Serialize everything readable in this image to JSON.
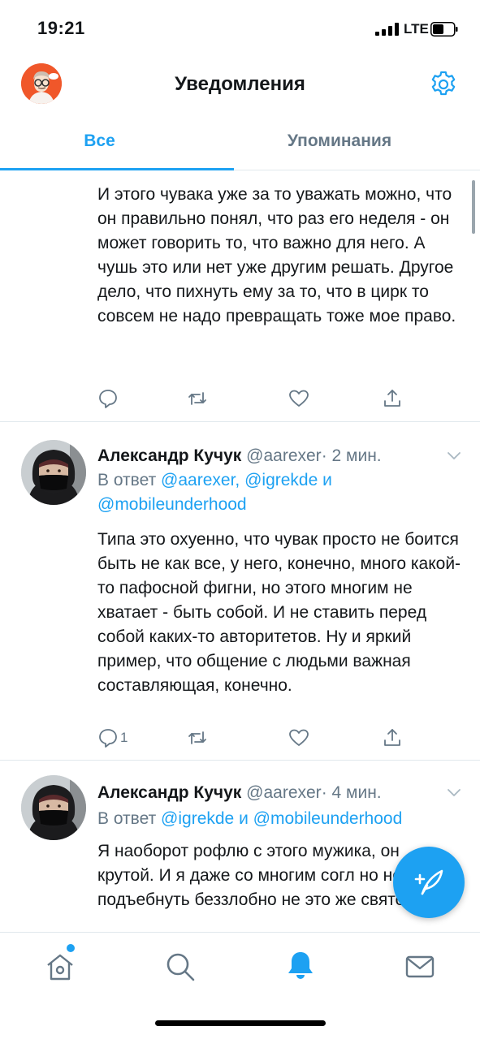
{
  "status_bar": {
    "time": "19:21",
    "network": "LTE"
  },
  "header": {
    "title": "Уведомления"
  },
  "tabs": [
    {
      "label": "Все",
      "active": true
    },
    {
      "label": "Упоминания",
      "active": false
    }
  ],
  "tweets": [
    {
      "text": "И этого чувака уже за то уважать можно, что он правильно понял, что раз его неделя - он может говорить то, что важно для него. А чушь это или нет уже другим решать. Другое дело, что пихнуть ему за то, что в цирк то совсем не надо превращать тоже мое право."
    },
    {
      "name": "Александр Кучук",
      "handle": "@aarexer",
      "separator": "·",
      "time": "2 мин.",
      "reply_prefix": "В ответ",
      "reply_links": [
        "@aarexer,",
        "@igrekde",
        "@mobileunderhood"
      ],
      "reply_joiner": "и",
      "text": "Типа это охуенно, что чувак просто не боится быть не как все, у него, конечно, много какой-то пафосной фигни, но этого многим не хватает - быть собой. И не ставить перед собой каких-то авторитетов. Ну и яркий пример, что общение с людьми важная составляющая, конечно.",
      "reply_count": "1"
    },
    {
      "name": "Александр Кучук",
      "handle": "@aarexer",
      "separator": "·",
      "time": "4 мин.",
      "reply_prefix": "В ответ",
      "reply_links": [
        "@igrekde",
        "@mobileunderhood"
      ],
      "reply_joiner": "и",
      "text": "Я наоборот рофлю с этого мужика, он крутой. И я даже со многим согл но не подъебнуть беззлобно не это же святое!"
    }
  ],
  "colors": {
    "accent": "#1da1f2",
    "muted": "#657786",
    "divider": "#e1e8ed"
  },
  "icons": [
    "settings-gear-icon",
    "reply-icon",
    "retweet-icon",
    "like-icon",
    "share-icon",
    "chevron-down-icon",
    "compose-tweet-icon",
    "home-icon",
    "search-icon",
    "notifications-bell-icon",
    "messages-envelope-icon"
  ]
}
